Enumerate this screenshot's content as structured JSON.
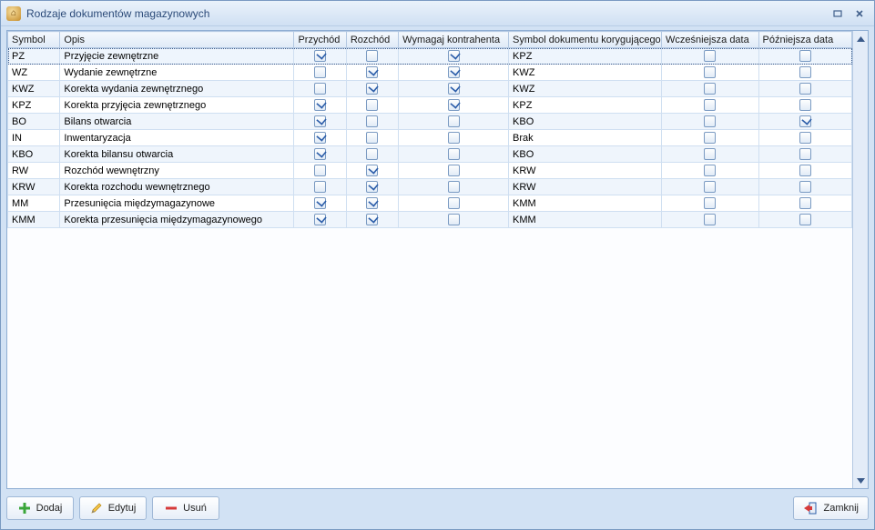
{
  "window": {
    "title": "Rodzaje dokumentów magazynowych"
  },
  "columns": {
    "symbol": "Symbol",
    "opis": "Opis",
    "przychod": "Przychód",
    "rozchod": "Rozchód",
    "wymagaj": "Wymagaj kontrahenta",
    "symkor": "Symbol dokumentu korygującego",
    "wczes": "Wcześniejsza data",
    "pozn": "Późniejsza data"
  },
  "rows": [
    {
      "symbol": "PZ",
      "opis": "Przyjęcie zewnętrzne",
      "przychod": true,
      "rozchod": false,
      "wymagaj": true,
      "symkor": "KPZ",
      "wczes": false,
      "pozn": false,
      "selected": true
    },
    {
      "symbol": "WZ",
      "opis": "Wydanie zewnętrzne",
      "przychod": false,
      "rozchod": true,
      "wymagaj": true,
      "symkor": "KWZ",
      "wczes": false,
      "pozn": false
    },
    {
      "symbol": "KWZ",
      "opis": "Korekta wydania zewnętrznego",
      "przychod": false,
      "rozchod": true,
      "wymagaj": true,
      "symkor": "KWZ",
      "wczes": false,
      "pozn": false
    },
    {
      "symbol": "KPZ",
      "opis": "Korekta przyjęcia zewnętrznego",
      "przychod": true,
      "rozchod": false,
      "wymagaj": true,
      "symkor": "KPZ",
      "wczes": false,
      "pozn": false
    },
    {
      "symbol": "BO",
      "opis": "Bilans otwarcia",
      "przychod": true,
      "rozchod": false,
      "wymagaj": false,
      "symkor": "KBO",
      "wczes": false,
      "pozn": true
    },
    {
      "symbol": "IN",
      "opis": "Inwentaryzacja",
      "przychod": true,
      "rozchod": false,
      "wymagaj": false,
      "symkor": "Brak",
      "wczes": false,
      "pozn": false
    },
    {
      "symbol": "KBO",
      "opis": "Korekta bilansu otwarcia",
      "przychod": true,
      "rozchod": false,
      "wymagaj": false,
      "symkor": "KBO",
      "wczes": false,
      "pozn": false
    },
    {
      "symbol": "RW",
      "opis": "Rozchód wewnętrzny",
      "przychod": false,
      "rozchod": true,
      "wymagaj": false,
      "symkor": "KRW",
      "wczes": false,
      "pozn": false
    },
    {
      "symbol": "KRW",
      "opis": "Korekta rozchodu wewnętrznego",
      "przychod": false,
      "rozchod": true,
      "wymagaj": false,
      "symkor": "KRW",
      "wczes": false,
      "pozn": false
    },
    {
      "symbol": "MM",
      "opis": "Przesunięcia międzymagazynowe",
      "przychod": true,
      "rozchod": true,
      "wymagaj": false,
      "symkor": "KMM",
      "wczes": false,
      "pozn": false
    },
    {
      "symbol": "KMM",
      "opis": "Korekta przesunięcia międzymagazynowego",
      "przychod": true,
      "rozchod": true,
      "wymagaj": false,
      "symkor": "KMM",
      "wczes": false,
      "pozn": false
    }
  ],
  "buttons": {
    "add": "Dodaj",
    "edit": "Edytuj",
    "delete": "Usuń",
    "close": "Zamknij"
  }
}
